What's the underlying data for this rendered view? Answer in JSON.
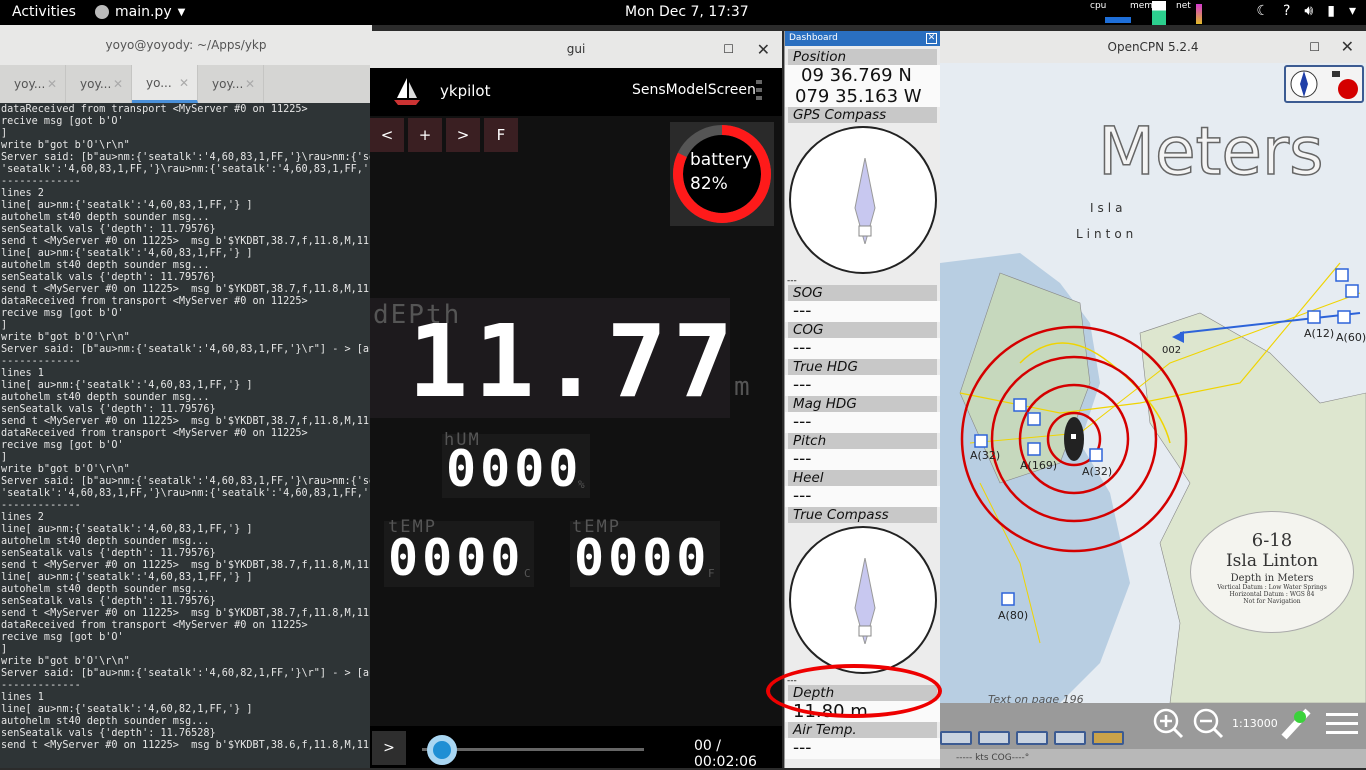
{
  "topbar": {
    "activities": "Activities",
    "app_name": "main.py",
    "clock": "Mon Dec  7, 17:37",
    "cpu_label": "cpu",
    "mem_label": "mem",
    "net_label": "net"
  },
  "terminal": {
    "title": "yoyo@yoyody: ~/Apps/ykp",
    "tabs": [
      "yoy...",
      "yoy...",
      "yo...",
      "yoy..."
    ],
    "lines": [
      "dataReceived from transport <MyServer #0 on 11225>",
      "recive msg [got b'O'",
      "]",
      "write b\"got b'O'\\r\\n\"",
      "Server said: [b\"au>nm:{'seatalk':'4,60,83,1,FF,'}\\rau>nm:{'sea",
      "'seatalk':'4,60,83,1,FF,'}\\rau>nm:{'seatalk':'4,60,83,1,FF,'}\\",
      "-------------",
      "lines 2",
      "line[ au>nm:{'seatalk':'4,60,83,1,FF,'} ]",
      "autohelm st40 depth sounder msg...",
      "senSeatalk vals {'depth': 11.79576}",
      "send t <MyServer #0 on 11225>  msg b'$YKDBT,38.7,f,11.8,M,11.8",
      "line[ au>nm:{'seatalk':'4,60,83,1,FF,'} ]",
      "autohelm st40 depth sounder msg...",
      "senSeatalk vals {'depth': 11.79576}",
      "send t <MyServer #0 on 11225>  msg b'$YKDBT,38.7,f,11.8,M,11.8",
      "dataReceived from transport <MyServer #0 on 11225>",
      "recive msg [got b'O'",
      "]",
      "write b\"got b'O'\\r\\n\"",
      "Server said: [b\"au>nm:{'seatalk':'4,60,83,1,FF,'}\\r\"] - > [au>",
      "-------------",
      "lines 1",
      "line[ au>nm:{'seatalk':'4,60,83,1,FF,'} ]",
      "autohelm st40 depth sounder msg...",
      "senSeatalk vals {'depth': 11.79576}",
      "send t <MyServer #0 on 11225>  msg b'$YKDBT,38.7,f,11.8,M,11.8",
      "dataReceived from transport <MyServer #0 on 11225>",
      "recive msg [got b'O'",
      "]",
      "write b\"got b'O'\\r\\n\"",
      "Server said: [b\"au>nm:{'seatalk':'4,60,83,1,FF,'}\\rau>nm:{'sea",
      "'seatalk':'4,60,83,1,FF,'}\\rau>nm:{'seatalk':'4,60,83,1,FF,'}\\",
      "-------------",
      "lines 2",
      "line[ au>nm:{'seatalk':'4,60,83,1,FF,'} ]",
      "autohelm st40 depth sounder msg...",
      "senSeatalk vals {'depth': 11.79576}",
      "send t <MyServer #0 on 11225>  msg b'$YKDBT,38.7,f,11.8,M,11.8",
      "line[ au>nm:{'seatalk':'4,60,83,1,FF,'} ]",
      "autohelm st40 depth sounder msg...",
      "senSeatalk vals {'depth': 11.79576}",
      "send t <MyServer #0 on 11225>  msg b'$YKDBT,38.7,f,11.8,M,11.8",
      "dataReceived from transport <MyServer #0 on 11225>",
      "recive msg [got b'O'",
      "]",
      "write b\"got b'O'\\r\\n\"",
      "Server said: [b\"au>nm:{'seatalk':'4,60,82,1,FF,'}\\r\"] - > [au>",
      "-------------",
      "lines 1",
      "line[ au>nm:{'seatalk':'4,60,82,1,FF,'} ]",
      "autohelm st40 depth sounder msg...",
      "senSeatalk vals {'depth': 11.76528}",
      "send t <MyServer #0 on 11225>  msg b'$YKDBT,38.6,f,11.8,M,11.8"
    ]
  },
  "gui": {
    "window_title": "gui",
    "app_title": "ykpilot",
    "overlap_text": "SensModelScreen",
    "nav_buttons": [
      "<",
      "+",
      ">",
      "F"
    ],
    "battery_label": "battery",
    "battery_percent": "82%",
    "battery_level": 0.82,
    "depth_label": "dEPth",
    "depth_value": "11.77",
    "depth_unit": "m",
    "hum_label": "hUM",
    "hum_value": "0000",
    "hum_unit": "%",
    "temp_c_label": "tEMP",
    "temp_c_value": "0000",
    "temp_c_unit": "C",
    "temp_f_label": "tEMP",
    "temp_f_value": "0000",
    "temp_f_unit": "F",
    "play_label": ">",
    "time": "00 / 00:02:06",
    "progress": 0.09
  },
  "dashboard": {
    "title": "Dashboard",
    "position_label": "Position",
    "lat": "09 36.769 N",
    "lon": "079 35.163 W",
    "gps_compass_label": "GPS Compass",
    "compass_dash": "---",
    "instruments": [
      {
        "label": "SOG",
        "value": "---"
      },
      {
        "label": "COG",
        "value": "---"
      },
      {
        "label": "True HDG",
        "value": "---"
      },
      {
        "label": "Mag HDG",
        "value": "---"
      },
      {
        "label": "Pitch",
        "value": "---"
      },
      {
        "label": "Heel",
        "value": "---"
      }
    ],
    "true_compass_label": "True Compass",
    "depth_label": "Depth",
    "depth_value": "11.80 m",
    "air_temp_label": "Air Temp.",
    "air_temp_value": "---"
  },
  "opencpn": {
    "window_title": "OpenCPN 5.2.4",
    "meters_watermark": "Meters",
    "island_name_1": "Isla",
    "island_name_2": "Linton",
    "chart_id": "6-18",
    "chart_title": "Isla Linton",
    "chart_subtitle": "Depth in Meters",
    "chart_note_1": "Vertical Datum : Low Water Springs",
    "chart_note_2": "Horizontal Datum : WGS 84",
    "chart_note_3": "Not for Navigation",
    "anchor_labels": [
      "A(32)",
      "A(169)",
      "A(32)",
      "A(80)",
      "A(12)",
      "A(60)"
    ],
    "wp_label": "002",
    "text_on_page": "Text on page 196",
    "scale": "1:13000",
    "status_text": "----- kts    COG----°"
  }
}
